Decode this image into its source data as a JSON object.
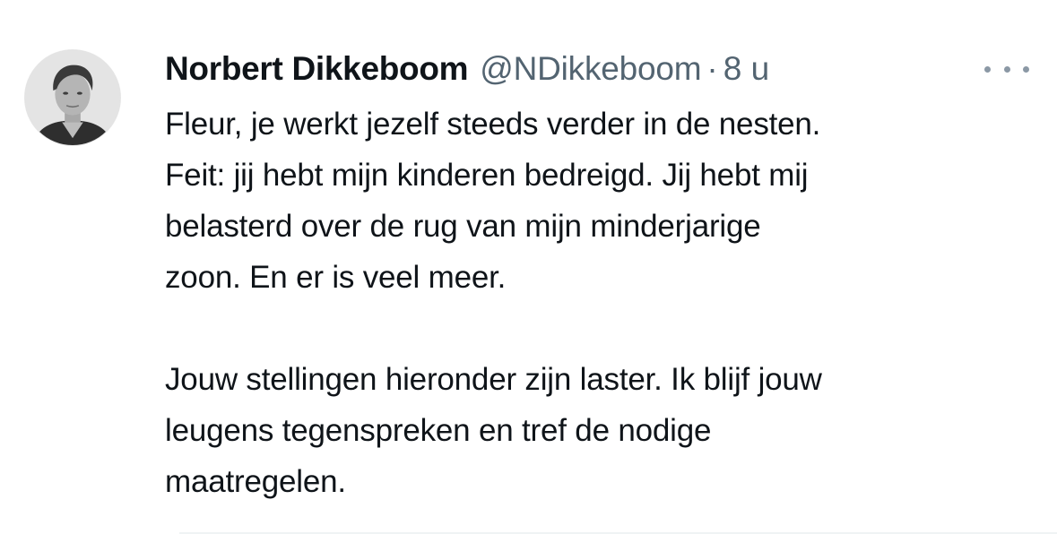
{
  "tweet": {
    "author": {
      "name": "Norbert Dikkeboom",
      "handle": "@NDikkeboom",
      "separator": "·",
      "time": "8 u"
    },
    "more_icon": "more-horizontal-icon",
    "paragraphs": [
      "Fleur, je werkt jezelf steeds verder in de nesten.\nFeit: jij hebt mijn kinderen bedreigd. Jij hebt mij\nbelasterd over de rug van mijn minderjarige\nzoon. En er is veel meer.",
      "Jouw stellingen hieronder zijn laster. Ik blijf jouw\nleugens tegenspreken en tref de nodige\nmaatregelen."
    ]
  },
  "colors": {
    "text_primary": "#0f1419",
    "text_secondary": "#536471",
    "icon_gray": "#8b98a5"
  }
}
